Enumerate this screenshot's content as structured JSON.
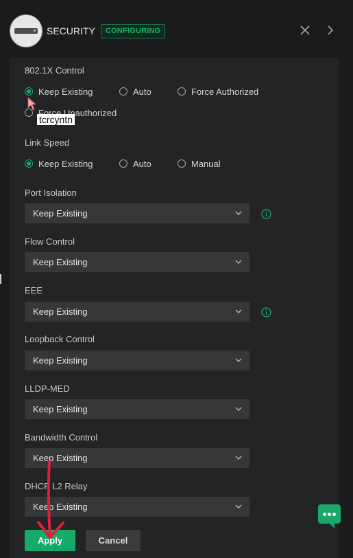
{
  "header": {
    "title": "SECURITY",
    "status_badge": "CONFIGURING",
    "accent_color": "#18b36b"
  },
  "dot1x": {
    "label": "802.1X Control",
    "options": [
      {
        "label": "Keep Existing",
        "checked": true
      },
      {
        "label": "Auto",
        "checked": false
      },
      {
        "label": "Force Authorized",
        "checked": false
      },
      {
        "label": "Force Unauthorized",
        "checked": false
      }
    ],
    "tooltip": "tcrcyntn"
  },
  "link_speed": {
    "label": "Link Speed",
    "options": [
      {
        "label": "Keep Existing",
        "checked": true
      },
      {
        "label": "Auto",
        "checked": false
      },
      {
        "label": "Manual",
        "checked": false
      }
    ]
  },
  "fields": [
    {
      "label": "Port Isolation",
      "value": "Keep Existing",
      "info": true
    },
    {
      "label": "Flow Control",
      "value": "Keep Existing",
      "info": false
    },
    {
      "label": "EEE",
      "value": "Keep Existing",
      "info": true
    },
    {
      "label": "Loopback Control",
      "value": "Keep Existing",
      "info": false
    },
    {
      "label": "LLDP-MED",
      "value": "Keep Existing",
      "info": false
    },
    {
      "label": "Bandwidth Control",
      "value": "Keep Existing",
      "info": false
    },
    {
      "label": "DHCP L2 Relay",
      "value": "Keep Existing",
      "info": false
    }
  ],
  "actions": {
    "apply": "Apply",
    "cancel": "Cancel"
  },
  "icons": {
    "close": "close-icon",
    "next": "chevron-right-icon",
    "chat": "chat-icon",
    "info": "info-icon"
  }
}
